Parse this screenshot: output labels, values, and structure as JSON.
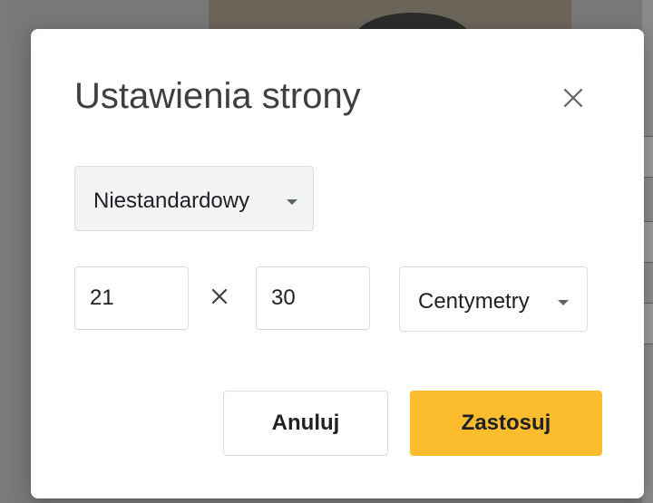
{
  "dialog": {
    "title": "Ustawienia strony",
    "close_icon": "close-icon",
    "preset": {
      "selected": "Niestandardowy",
      "icon": "chevron-down-icon"
    },
    "size": {
      "width": "21",
      "height": "30",
      "separator_icon": "multiply-icon"
    },
    "units": {
      "selected": "Centymetry",
      "icon": "chevron-down-icon"
    },
    "buttons": {
      "cancel_label": "Anuluj",
      "apply_label": "Zastosuj"
    }
  },
  "colors": {
    "accent": "#fbbc2d",
    "text": "#202124",
    "title": "#3c4043",
    "border": "#dadce0",
    "select_bg": "#f1f3f4"
  }
}
